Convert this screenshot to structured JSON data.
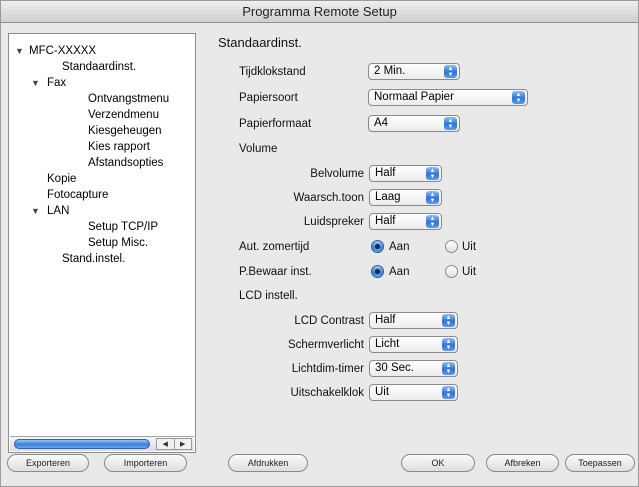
{
  "window": {
    "title": "Programma Remote Setup"
  },
  "tree": {
    "root": "MFC-XXXXX",
    "items": [
      "Standaardinst.",
      "Fax",
      "Ontvangstmenu",
      "Verzendmenu",
      "Kiesgeheugen",
      "Kies rapport",
      "Afstandsopties",
      "Kopie",
      "Fotocapture",
      "LAN",
      "Setup TCP/IP",
      "Setup Misc.",
      "Stand.instel."
    ],
    "selected": "Standaardinst."
  },
  "panel": {
    "title": "Standaardinst.",
    "tijdklokstand": {
      "label": "Tijdklokstand",
      "value": "2 Min."
    },
    "papiersoort": {
      "label": "Papiersoort",
      "value": "Normaal Papier"
    },
    "papierformaat": {
      "label": "Papierformaat",
      "value": "A4"
    },
    "volume": {
      "heading": "Volume",
      "belvolume": {
        "label": "Belvolume",
        "value": "Half"
      },
      "waarsch": {
        "label": "Waarsch.toon",
        "value": "Laag"
      },
      "luidspreker": {
        "label": "Luidspreker",
        "value": "Half"
      }
    },
    "zomertijd": {
      "label": "Aut. zomertijd",
      "on": "Aan",
      "off": "Uit",
      "selected": "Aan"
    },
    "pbewaar": {
      "label": "P.Bewaar inst.",
      "on": "Aan",
      "off": "Uit",
      "selected": "Aan"
    },
    "lcd": {
      "heading": "LCD instell.",
      "contrast": {
        "label": "LCD Contrast",
        "value": "Half"
      },
      "schermverlicht": {
        "label": "Schermverlicht",
        "value": "Licht"
      },
      "lichtdim": {
        "label": "Lichtdim-timer",
        "value": "30 Sec."
      },
      "uitschakelklok": {
        "label": "Uitschakelklok",
        "value": "Uit"
      }
    }
  },
  "buttons": {
    "exporteren": "Exporteren",
    "importeren": "Importeren",
    "afdrukken": "Afdrukken",
    "ok": "OK",
    "afbreken": "Afbreken",
    "toepassen": "Toepassen"
  },
  "colors": {
    "accent": "#3a7ddb",
    "window_bg": "#e9e9e9"
  }
}
